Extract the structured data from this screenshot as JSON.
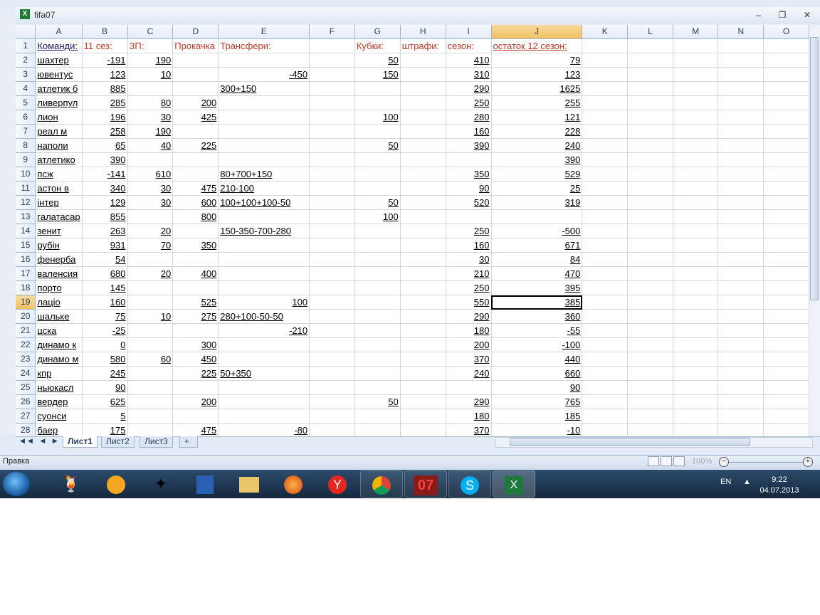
{
  "window": {
    "title": "fifa07",
    "minimize": "–",
    "restore": "❐",
    "close": "✕"
  },
  "columns": [
    "A",
    "B",
    "C",
    "D",
    "E",
    "F",
    "G",
    "H",
    "I",
    "J",
    "K",
    "L",
    "M",
    "N",
    "O"
  ],
  "selected_cell": "J19",
  "rows": [
    {
      "n": "1",
      "A": "Команди:",
      "B": "11 сез:",
      "C": "ЗП:",
      "D": "Прокачка",
      "E": "Трансфери:",
      "F": "",
      "G": "Кубки:",
      "H": "штрафи:",
      "I": "сезон:",
      "J": "остаток 12 сезон:"
    },
    {
      "n": "2",
      "A": "шахтер",
      "B": "-191",
      "C": "190",
      "D": "",
      "E": "",
      "F": "",
      "G": "50",
      "H": "",
      "I": "410",
      "J": "79"
    },
    {
      "n": "3",
      "A": "ювентус",
      "B": "123",
      "C": "10",
      "D": "",
      "E": "-450",
      "F": "",
      "G": "150",
      "H": "",
      "I": "310",
      "J": "123"
    },
    {
      "n": "4",
      "A": "атлетик б",
      "B": "885",
      "C": "",
      "D": "",
      "E": "300+150",
      "F": "",
      "G": "",
      "H": "",
      "I": "290",
      "J": "1625"
    },
    {
      "n": "5",
      "A": "ливерпул",
      "B": "285",
      "C": "80",
      "D": "200",
      "E": "",
      "F": "",
      "G": "",
      "H": "",
      "I": "250",
      "J": "255"
    },
    {
      "n": "6",
      "A": "лион",
      "B": "196",
      "C": "30",
      "D": "425",
      "E": "",
      "F": "",
      "G": "100",
      "H": "",
      "I": "280",
      "J": "121"
    },
    {
      "n": "7",
      "A": "реал м",
      "B": "258",
      "C": "190",
      "D": "",
      "E": "",
      "F": "",
      "G": "",
      "H": "",
      "I": "160",
      "J": "228"
    },
    {
      "n": "8",
      "A": "наполи",
      "B": "65",
      "C": "40",
      "D": "225",
      "E": "",
      "F": "",
      "G": "50",
      "H": "",
      "I": "390",
      "J": "240"
    },
    {
      "n": "9",
      "A": "атлетико",
      "B": "390",
      "C": "",
      "D": "",
      "E": "",
      "F": "",
      "G": "",
      "H": "",
      "I": "",
      "J": "390"
    },
    {
      "n": "10",
      "A": "псж",
      "B": "-141",
      "C": "610",
      "D": "",
      "E": "80+700+150",
      "F": "",
      "G": "",
      "H": "",
      "I": "350",
      "J": "529"
    },
    {
      "n": "11",
      "A": "астон в",
      "B": "340",
      "C": "30",
      "D": "475",
      "E": "210-100",
      "F": "",
      "G": "",
      "H": "",
      "I": "90",
      "J": "25"
    },
    {
      "n": "12",
      "A": "інтер",
      "B": "129",
      "C": "30",
      "D": "600",
      "E": "100+100+100-50",
      "F": "",
      "G": "50",
      "H": "",
      "I": "520",
      "J": "319"
    },
    {
      "n": "13",
      "A": "галатасар",
      "B": "855",
      "C": "",
      "D": "800",
      "E": "",
      "F": "",
      "G": "100",
      "H": "",
      "I": "",
      "J": ""
    },
    {
      "n": "14",
      "A": "зенит",
      "B": "263",
      "C": "20",
      "D": "",
      "E": "150-350-700-280",
      "F": "",
      "G": "",
      "H": "",
      "I": "250",
      "J": "-500"
    },
    {
      "n": "15",
      "A": "рубін",
      "B": "931",
      "C": "70",
      "D": "350",
      "E": "",
      "F": "",
      "G": "",
      "H": "",
      "I": "160",
      "J": "671"
    },
    {
      "n": "16",
      "A": "фенерба",
      "B": "54",
      "C": "",
      "D": "",
      "E": "",
      "F": "",
      "G": "",
      "H": "",
      "I": "30",
      "J": "84"
    },
    {
      "n": "17",
      "A": "валенсия",
      "B": "680",
      "C": "20",
      "D": "400",
      "E": "",
      "F": "",
      "G": "",
      "H": "",
      "I": "210",
      "J": "470"
    },
    {
      "n": "18",
      "A": "порто",
      "B": "145",
      "C": "",
      "D": "",
      "E": "",
      "F": "",
      "G": "",
      "H": "",
      "I": "250",
      "J": "395"
    },
    {
      "n": "19",
      "A": "лаціо",
      "B": "160",
      "C": "",
      "D": "525",
      "E": "100",
      "F": "",
      "G": "",
      "H": "",
      "I": "550",
      "J": "385"
    },
    {
      "n": "20",
      "A": "шальке",
      "B": "75",
      "C": "10",
      "D": "275",
      "E": "280+100-50-50",
      "F": "",
      "G": "",
      "H": "",
      "I": "290",
      "J": "360"
    },
    {
      "n": "21",
      "A": "цска",
      "B": "-25",
      "C": "",
      "D": "",
      "E": "-210",
      "F": "",
      "G": "",
      "H": "",
      "I": "180",
      "J": "-55"
    },
    {
      "n": "22",
      "A": "динамо к",
      "B": "0",
      "C": "",
      "D": "300",
      "E": "",
      "F": "",
      "G": "",
      "H": "",
      "I": "200",
      "J": "-100"
    },
    {
      "n": "23",
      "A": "динамо м",
      "B": "580",
      "C": "60",
      "D": "450",
      "E": "",
      "F": "",
      "G": "",
      "H": "",
      "I": "370",
      "J": "440"
    },
    {
      "n": "24",
      "A": "кпр",
      "B": "245",
      "C": "",
      "D": "225",
      "E": "50+350",
      "F": "",
      "G": "",
      "H": "",
      "I": "240",
      "J": "660"
    },
    {
      "n": "25",
      "A": "ньюкасл",
      "B": "90",
      "C": "",
      "D": "",
      "E": "",
      "F": "",
      "G": "",
      "H": "",
      "I": "",
      "J": "90"
    },
    {
      "n": "26",
      "A": "вердер",
      "B": "625",
      "C": "",
      "D": "200",
      "E": "",
      "F": "",
      "G": "50",
      "H": "",
      "I": "290",
      "J": "765"
    },
    {
      "n": "27",
      "A": "суонси",
      "B": "5",
      "C": "",
      "D": "",
      "E": "",
      "F": "",
      "G": "",
      "H": "",
      "I": "180",
      "J": "185"
    },
    {
      "n": "28",
      "A": "баер",
      "B": "175",
      "C": "",
      "D": "475",
      "E": "-80",
      "F": "",
      "G": "",
      "H": "",
      "I": "370",
      "J": "-10"
    }
  ],
  "sheet_tabs": [
    "Лист1",
    "Лист2",
    "Лист3"
  ],
  "tab_nav": "◀◀ ◀ ▶ ▶▶",
  "status": {
    "mode": "Правка",
    "zoom": "100%"
  },
  "taskbar": {
    "apps": [
      "cocktail",
      "aimp",
      "mascot",
      "save",
      "folder",
      "firefox",
      "yandex",
      "chrome",
      "fifa",
      "skype",
      "excel"
    ],
    "fifa_label": "07",
    "language": "EN",
    "time": "9:22",
    "date": "04.07.2013"
  }
}
